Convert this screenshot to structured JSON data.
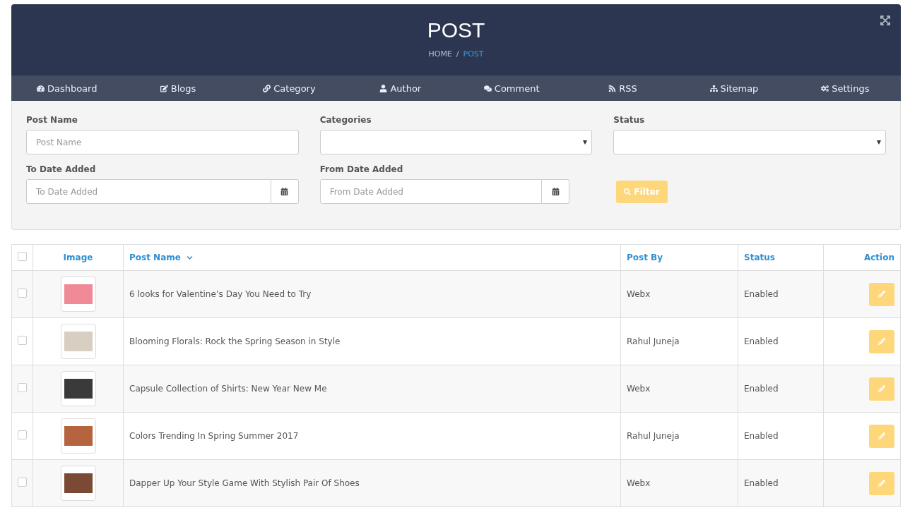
{
  "header": {
    "title": "POST",
    "breadcrumb_separator": "/",
    "breadcrumb": [
      {
        "label": "HOME",
        "selected": false
      },
      {
        "label": "POST",
        "selected": true
      }
    ]
  },
  "nav": [
    "Dashboard",
    "Blogs",
    "Category",
    "Author",
    "Comment",
    "RSS",
    "Sitemap",
    "Settings"
  ],
  "filters": {
    "post_name": {
      "label": "Post Name",
      "placeholder": "Post Name"
    },
    "categories": {
      "label": "Categories"
    },
    "status": {
      "label": "Status"
    },
    "to_date": {
      "label": "To Date Added",
      "placeholder": "To Date Added"
    },
    "from_date": {
      "label": "From Date Added",
      "placeholder": "From Date Added"
    },
    "filter_button": "Filter"
  },
  "table": {
    "select_all_checked": false,
    "columns": [
      "Image",
      "Post Name",
      "Post By",
      "Status",
      "Action"
    ],
    "rows": [
      {
        "checked": false,
        "post_name": "6 looks for Valentine’s Day You Need to Try",
        "post_by": "Webx",
        "status": "Enabled"
      },
      {
        "checked": false,
        "post_name": "Blooming Florals: Rock the Spring Season in Style",
        "post_by": "Rahul Juneja",
        "status": "Enabled"
      },
      {
        "checked": false,
        "post_name": "Capsule Collection of Shirts: New Year New Me",
        "post_by": "Webx",
        "status": "Enabled"
      },
      {
        "checked": false,
        "post_name": "Colors Trending In Spring Summer 2017",
        "post_by": "Rahul Juneja",
        "status": "Enabled"
      },
      {
        "checked": false,
        "post_name": "Dapper Up Your Style Game With Stylish Pair Of Shoes",
        "post_by": "Webx",
        "status": "Enabled"
      }
    ]
  }
}
